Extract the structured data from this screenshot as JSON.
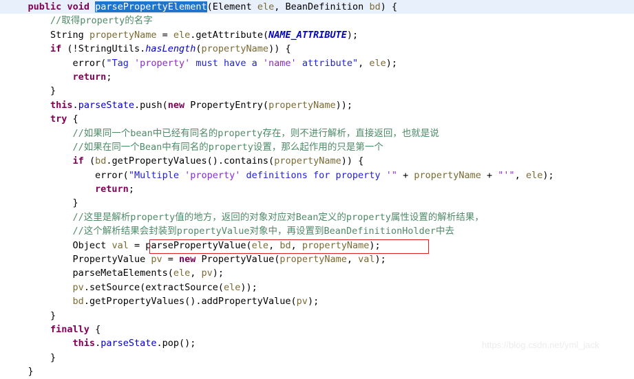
{
  "editor": {
    "language": "java",
    "background_color": "#ffffff",
    "current_line_highlight_color": "#e8f0fb",
    "selection_color": "#1f74cb",
    "annotation_box_color": "#e02020",
    "font_size_px": 13.5,
    "line_height_px": 20.4
  },
  "watermark": {
    "text": "https://blog.csdn.net/yml_jack",
    "color": "#ececec"
  },
  "annotation": {
    "type": "rectangle",
    "label": "parse-property-value-call-highlight",
    "target_text": "parsePropertyValue(ele, bd, propertyName);"
  },
  "selection": {
    "text": "parsePropertyElement",
    "line": 1
  },
  "code_lines": [
    {
      "n": 1,
      "current": true,
      "tokens": [
        {
          "t": "    ",
          "c": "plain"
        },
        {
          "t": "public",
          "c": "kw"
        },
        {
          "t": " ",
          "c": "plain"
        },
        {
          "t": "void",
          "c": "kw"
        },
        {
          "t": " ",
          "c": "plain"
        },
        {
          "t": "parsePropertyElement",
          "c": "sel"
        },
        {
          "t": "(",
          "c": "plain"
        },
        {
          "t": "Element",
          "c": "type"
        },
        {
          "t": " ",
          "c": "plain"
        },
        {
          "t": "ele",
          "c": "par"
        },
        {
          "t": ", ",
          "c": "plain"
        },
        {
          "t": "BeanDefinition",
          "c": "type"
        },
        {
          "t": " ",
          "c": "plain"
        },
        {
          "t": "bd",
          "c": "par"
        },
        {
          "t": ") {",
          "c": "plain"
        }
      ]
    },
    {
      "n": 2,
      "current": false,
      "tokens": [
        {
          "t": "        //取得property的名字",
          "c": "cmt"
        }
      ]
    },
    {
      "n": 3,
      "current": false,
      "tokens": [
        {
          "t": "        ",
          "c": "plain"
        },
        {
          "t": "String",
          "c": "type"
        },
        {
          "t": " ",
          "c": "plain"
        },
        {
          "t": "propertyName",
          "c": "par"
        },
        {
          "t": " = ",
          "c": "plain"
        },
        {
          "t": "ele",
          "c": "par"
        },
        {
          "t": ".getAttribute(",
          "c": "plain"
        },
        {
          "t": "NAME_ATTRIBUTE",
          "c": "cfield"
        },
        {
          "t": ");",
          "c": "plain"
        }
      ]
    },
    {
      "n": 4,
      "current": false,
      "tokens": [
        {
          "t": "        ",
          "c": "plain"
        },
        {
          "t": "if",
          "c": "kw"
        },
        {
          "t": " (!",
          "c": "plain"
        },
        {
          "t": "StringUtils",
          "c": "type"
        },
        {
          "t": ".",
          "c": "plain"
        },
        {
          "t": "hasLength",
          "c": "stat"
        },
        {
          "t": "(",
          "c": "plain"
        },
        {
          "t": "propertyName",
          "c": "par"
        },
        {
          "t": ")) {",
          "c": "plain"
        }
      ]
    },
    {
      "n": 5,
      "current": false,
      "tokens": [
        {
          "t": "            error(",
          "c": "plain"
        },
        {
          "t": "\"Tag ",
          "c": "str"
        },
        {
          "t": "'property'",
          "c": "strq"
        },
        {
          "t": " must have a ",
          "c": "str"
        },
        {
          "t": "'name'",
          "c": "strq"
        },
        {
          "t": " attribute\"",
          "c": "str"
        },
        {
          "t": ", ",
          "c": "plain"
        },
        {
          "t": "ele",
          "c": "par"
        },
        {
          "t": ");",
          "c": "plain"
        }
      ]
    },
    {
      "n": 6,
      "current": false,
      "tokens": [
        {
          "t": "            ",
          "c": "plain"
        },
        {
          "t": "return",
          "c": "kw"
        },
        {
          "t": ";",
          "c": "plain"
        }
      ]
    },
    {
      "n": 7,
      "current": false,
      "tokens": [
        {
          "t": "        }",
          "c": "plain"
        }
      ]
    },
    {
      "n": 8,
      "current": false,
      "tokens": [
        {
          "t": "        ",
          "c": "plain"
        },
        {
          "t": "this",
          "c": "kw"
        },
        {
          "t": ".",
          "c": "plain"
        },
        {
          "t": "parseState",
          "c": "fld"
        },
        {
          "t": ".push(",
          "c": "plain"
        },
        {
          "t": "new",
          "c": "kw"
        },
        {
          "t": " PropertyEntry(",
          "c": "plain"
        },
        {
          "t": "propertyName",
          "c": "par"
        },
        {
          "t": "));",
          "c": "plain"
        }
      ]
    },
    {
      "n": 9,
      "current": false,
      "tokens": [
        {
          "t": "        ",
          "c": "plain"
        },
        {
          "t": "try",
          "c": "kw"
        },
        {
          "t": " {",
          "c": "plain"
        }
      ]
    },
    {
      "n": 10,
      "current": false,
      "tokens": [
        {
          "t": "            //如果同一个bean中已经有同名的property存在，则不进行解析，直接返回，也就是说",
          "c": "cmt"
        }
      ]
    },
    {
      "n": 11,
      "current": false,
      "tokens": [
        {
          "t": "            //如果在同一个Bean中有同名的property设置，那么起作用的只是第一个",
          "c": "cmt"
        }
      ]
    },
    {
      "n": 12,
      "current": false,
      "tokens": [
        {
          "t": "            ",
          "c": "plain"
        },
        {
          "t": "if",
          "c": "kw"
        },
        {
          "t": " (",
          "c": "plain"
        },
        {
          "t": "bd",
          "c": "par"
        },
        {
          "t": ".getPropertyValues().contains(",
          "c": "plain"
        },
        {
          "t": "propertyName",
          "c": "par"
        },
        {
          "t": ")) {",
          "c": "plain"
        }
      ]
    },
    {
      "n": 13,
      "current": false,
      "tokens": [
        {
          "t": "                error(",
          "c": "plain"
        },
        {
          "t": "\"Multiple ",
          "c": "str"
        },
        {
          "t": "'property'",
          "c": "strq"
        },
        {
          "t": " definitions for property ",
          "c": "str"
        },
        {
          "t": "'\"",
          "c": "strq"
        },
        {
          "t": " + ",
          "c": "plain"
        },
        {
          "t": "propertyName",
          "c": "par"
        },
        {
          "t": " + ",
          "c": "plain"
        },
        {
          "t": "\"'\"",
          "c": "strq"
        },
        {
          "t": ", ",
          "c": "plain"
        },
        {
          "t": "ele",
          "c": "par"
        },
        {
          "t": ");",
          "c": "plain"
        }
      ]
    },
    {
      "n": 14,
      "current": false,
      "tokens": [
        {
          "t": "                ",
          "c": "plain"
        },
        {
          "t": "return",
          "c": "kw"
        },
        {
          "t": ";",
          "c": "plain"
        }
      ]
    },
    {
      "n": 15,
      "current": false,
      "tokens": [
        {
          "t": "            }",
          "c": "plain"
        }
      ]
    },
    {
      "n": 16,
      "current": false,
      "tokens": [
        {
          "t": "            //这里是解析property值的地方，返回的对象对应对Bean定义的property属性设置的解析结果，",
          "c": "cmt"
        }
      ]
    },
    {
      "n": 17,
      "current": false,
      "tokens": [
        {
          "t": "            //这个解析结果会封装到propertyValue对象中，再设置到BeanDefinitionHolder中去",
          "c": "cmt"
        }
      ]
    },
    {
      "n": 18,
      "current": false,
      "tokens": [
        {
          "t": "            ",
          "c": "plain"
        },
        {
          "t": "Object",
          "c": "type"
        },
        {
          "t": " ",
          "c": "plain"
        },
        {
          "t": "val",
          "c": "par"
        },
        {
          "t": " = parsePropertyValue(",
          "c": "plain"
        },
        {
          "t": "ele",
          "c": "par"
        },
        {
          "t": ", ",
          "c": "plain"
        },
        {
          "t": "bd",
          "c": "par"
        },
        {
          "t": ", ",
          "c": "plain"
        },
        {
          "t": "propertyName",
          "c": "par"
        },
        {
          "t": ");",
          "c": "plain"
        }
      ]
    },
    {
      "n": 19,
      "current": false,
      "tokens": [
        {
          "t": "            ",
          "c": "plain"
        },
        {
          "t": "PropertyValue",
          "c": "type"
        },
        {
          "t": " ",
          "c": "plain"
        },
        {
          "t": "pv",
          "c": "par"
        },
        {
          "t": " = ",
          "c": "plain"
        },
        {
          "t": "new",
          "c": "kw"
        },
        {
          "t": " PropertyValue(",
          "c": "plain"
        },
        {
          "t": "propertyName",
          "c": "par"
        },
        {
          "t": ", ",
          "c": "plain"
        },
        {
          "t": "val",
          "c": "par"
        },
        {
          "t": ");",
          "c": "plain"
        }
      ]
    },
    {
      "n": 20,
      "current": false,
      "tokens": [
        {
          "t": "            parseMetaElements(",
          "c": "plain"
        },
        {
          "t": "ele",
          "c": "par"
        },
        {
          "t": ", ",
          "c": "plain"
        },
        {
          "t": "pv",
          "c": "par"
        },
        {
          "t": ");",
          "c": "plain"
        }
      ]
    },
    {
      "n": 21,
      "current": false,
      "tokens": [
        {
          "t": "            ",
          "c": "plain"
        },
        {
          "t": "pv",
          "c": "par"
        },
        {
          "t": ".setSource(extractSource(",
          "c": "plain"
        },
        {
          "t": "ele",
          "c": "par"
        },
        {
          "t": "));",
          "c": "plain"
        }
      ]
    },
    {
      "n": 22,
      "current": false,
      "tokens": [
        {
          "t": "            ",
          "c": "plain"
        },
        {
          "t": "bd",
          "c": "par"
        },
        {
          "t": ".getPropertyValues().addPropertyValue(",
          "c": "plain"
        },
        {
          "t": "pv",
          "c": "par"
        },
        {
          "t": ");",
          "c": "plain"
        }
      ]
    },
    {
      "n": 23,
      "current": false,
      "tokens": [
        {
          "t": "        }",
          "c": "plain"
        }
      ]
    },
    {
      "n": 24,
      "current": false,
      "tokens": [
        {
          "t": "        ",
          "c": "plain"
        },
        {
          "t": "finally",
          "c": "kw"
        },
        {
          "t": " {",
          "c": "plain"
        }
      ]
    },
    {
      "n": 25,
      "current": false,
      "tokens": [
        {
          "t": "            ",
          "c": "plain"
        },
        {
          "t": "this",
          "c": "kw"
        },
        {
          "t": ".",
          "c": "plain"
        },
        {
          "t": "parseState",
          "c": "fld"
        },
        {
          "t": ".pop();",
          "c": "plain"
        }
      ]
    },
    {
      "n": 26,
      "current": false,
      "tokens": [
        {
          "t": "        }",
          "c": "plain"
        }
      ]
    },
    {
      "n": 27,
      "current": false,
      "tokens": [
        {
          "t": "    }",
          "c": "plain"
        }
      ]
    }
  ]
}
